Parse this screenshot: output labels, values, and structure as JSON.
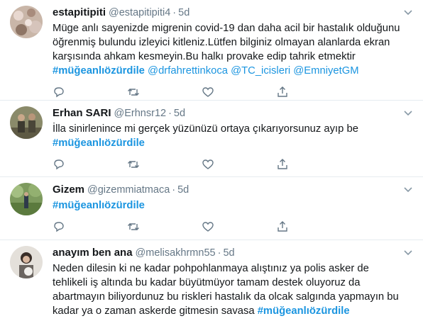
{
  "tweets": [
    {
      "name": "estapitipiti",
      "handle": "@estapitipiti4",
      "dot": "·",
      "time": "5d",
      "lines": [
        "Müge anlı sayenizde migrenin covid-19 dan daha acil bir hastalık olduğunu",
        "öğrenmiş bulundu izleyici kitleniz.Lütfen bilginiz olmayan alanlarda ekran",
        "karşısında ahkam kesmeyin.Bu halkı provake edip tahrik etmektir"
      ],
      "hashtag": "#müğeanlıözürdile",
      "mentions": [
        "@drfahrettinkoca",
        "@TC_icisleri",
        "@EmniyetGM"
      ]
    },
    {
      "name": "Erhan SARI",
      "handle": "@Erhnsr12",
      "dot": "·",
      "time": "5d",
      "lines": [
        "İlla sinirlenince mi gerçek yüzünüzü ortaya çıkarıyorsunuz ayıp be"
      ],
      "hashtag": "#müğeanlıözürdile"
    },
    {
      "name": "Gizem",
      "handle": "@gizemmiatmaca",
      "dot": "·",
      "time": "5d",
      "hashtag": "#müğeanlıözürdile"
    },
    {
      "name": "anayım ben ana",
      "handle": "@melisakhrmn55",
      "dot": "·",
      "time": "5d",
      "lines": [
        "Neden dilesin ki ne kadar pohpohlanmaya alıştınız ya polis asker de",
        "tehlikeli iş altında bu kadar büyütmüyor tamam destek oluyoruz da",
        "abartmayın biliyordunuz bu riskleri hastalık da olcak salgında yapmayın bu",
        "kadar ya o zaman askerde gitmesin savasa"
      ],
      "hashtag": "#müğeanlıözürdile"
    }
  ],
  "colors": {
    "link": "#1b95e0",
    "muted": "#657786",
    "text": "#14171a",
    "border": "#e6ecf0"
  },
  "icons": [
    "reply-icon",
    "retweet-icon",
    "like-icon",
    "share-icon",
    "chevron-down-icon"
  ]
}
